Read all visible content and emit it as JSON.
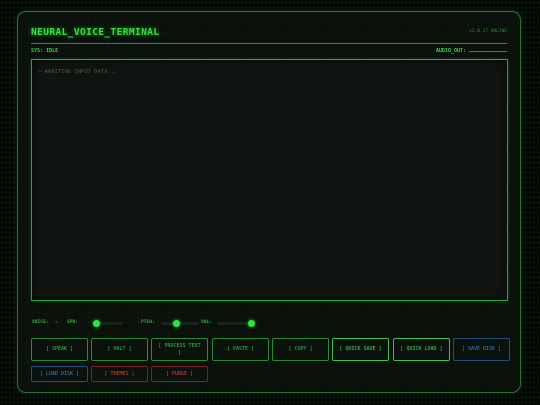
{
  "header": {
    "title": "NEURAL_VOICE_TERMINAL",
    "version": "v2.0.17 ONLINE",
    "sys_status": "SYS: IDLE",
    "audio_out_label": "AUDIO_OUT:"
  },
  "terminal": {
    "placeholder": "> AWAITING INPUT DATA..."
  },
  "controls": {
    "voice_label": "VOICE:",
    "voice_select": "▾",
    "spd_label": "SPD:",
    "pitch_label": "PTCH:",
    "vol_label": "VOL:",
    "spd_value": 0.1,
    "pitch_value": 0.4,
    "vol_value": 0.95
  },
  "buttons": {
    "speak": "[ SPEAK ]",
    "halt": "[ HALT ]",
    "process_text": "[ PROCESS TEXT ]",
    "paste": "[ PASTE ]",
    "copy": "[ COPY ]",
    "quick_save": "[ QUICK SAVE ]",
    "quick_load": "[ QUICK LOAD ]",
    "save_disk": "[ SAVE DISK ]",
    "load_disk": "[ LOAD DISK ]",
    "themes": "[ THEMES ]",
    "purge": "[ PURGE ]"
  },
  "colors": {
    "accent_green": "#2ee63c",
    "disk_blue": "#3a86c8",
    "danger_red": "#d6433c"
  }
}
